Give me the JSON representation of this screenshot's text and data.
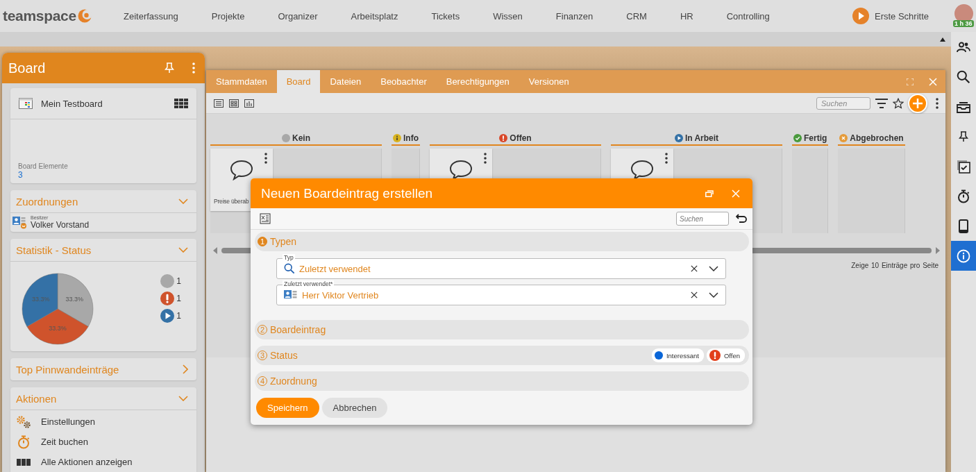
{
  "top_nav": {
    "logo": "teamspace",
    "items": [
      "Zeiterfassung",
      "Projekte",
      "Organizer",
      "Arbeitsplatz",
      "Tickets",
      "Wissen",
      "Finanzen",
      "CRM",
      "HR",
      "Controlling"
    ],
    "getting_started": "Erste Schritte",
    "timer_badge": "1 h 36"
  },
  "right_rail": [
    {
      "kind": "contacts",
      "selected": false
    },
    {
      "kind": "search",
      "selected": false
    },
    {
      "kind": "inbox",
      "selected": false
    },
    {
      "kind": "pin",
      "selected": false
    },
    {
      "kind": "tasks",
      "selected": false
    },
    {
      "kind": "stopwatch",
      "selected": false
    },
    {
      "kind": "phone",
      "selected": false
    },
    {
      "kind": "info",
      "selected": true
    }
  ],
  "board_panel": {
    "title": "Board",
    "board": {
      "name": "Mein Testboard",
      "elements_label": "Board Elemente",
      "elements_count": "3"
    },
    "sections": [
      {
        "kind": "assignments",
        "title": "Zuordnungen",
        "expanded": true,
        "owner_label": "Besitzer",
        "owner": "Volker Vorstand"
      },
      {
        "kind": "statistics",
        "title": "Statistik - Status",
        "expanded": true,
        "chart_data": {
          "type": "pie",
          "values": [
            33.3,
            33.3,
            33.3
          ],
          "value_labels": [
            "33.3%",
            "33.3%",
            "33.3%"
          ]
        },
        "legend": [
          {
            "kind": "neutral",
            "color": "#a8a8a8",
            "count": "1"
          },
          {
            "kind": "open",
            "color": "#cf532c",
            "count": "1"
          },
          {
            "kind": "progress",
            "color": "#3471a6",
            "count": "1"
          }
        ]
      },
      {
        "kind": "pinboard",
        "title": "Top Pinnwandeinträge",
        "expanded": false
      },
      {
        "kind": "actions",
        "title": "Aktionen",
        "expanded": true,
        "items": [
          {
            "kind": "settings",
            "label": "Einstellungen"
          },
          {
            "kind": "time",
            "label": "Zeit buchen"
          },
          {
            "kind": "all",
            "label": "Alle Aktionen anzeigen"
          }
        ]
      }
    ]
  },
  "board_window": {
    "tabs": [
      {
        "label": "Stammdaten",
        "selected": false
      },
      {
        "label": "Board",
        "selected": true
      },
      {
        "label": "Dateien",
        "selected": false
      },
      {
        "label": "Beobachter",
        "selected": false
      },
      {
        "label": "Berechtigungen",
        "selected": false
      },
      {
        "label": "Versionen",
        "selected": false
      }
    ],
    "search": {
      "placeholder": "Suchen"
    },
    "columns": [
      {
        "kind": "neutral",
        "title": "Kein",
        "has_card": true,
        "card_text": "Preise überab"
      },
      {
        "kind": "info",
        "title": "Info",
        "has_card": false
      },
      {
        "kind": "open",
        "title": "Offen",
        "has_card": true
      },
      {
        "kind": "progress",
        "title": "In Arbeit",
        "has_card": true
      },
      {
        "kind": "done",
        "title": "Fertig",
        "has_card": false
      },
      {
        "kind": "cancelled",
        "title": "Abgebrochen",
        "has_card": false
      }
    ],
    "paging": {
      "prefix": "Zeige",
      "page_size": "10",
      "suffix": "Einträge pro Seite"
    }
  },
  "dialog": {
    "title": "Neuen Boardeintrag erstellen",
    "search": {
      "placeholder": "Suchen"
    },
    "sections": [
      {
        "number": "1",
        "title": "Typen",
        "expanded": true,
        "fields": [
          {
            "kind": "search",
            "label": "Typ",
            "value": "Zuletzt verwendet"
          },
          {
            "kind": "contact",
            "label": "Zuletzt verwendet*",
            "value": "Herr Viktor Vertrieb"
          }
        ]
      },
      {
        "number": "2",
        "title": "Boardeintrag",
        "expanded": false
      },
      {
        "number": "3",
        "title": "Status",
        "expanded": false,
        "chips": [
          {
            "kind": "dot",
            "label": "Interessant",
            "color": "#0a66d8"
          },
          {
            "kind": "open",
            "label": "Offen",
            "color": "#e2401c"
          }
        ]
      },
      {
        "number": "4",
        "title": "Zuordnung",
        "expanded": false
      }
    ],
    "buttons": [
      {
        "kind": "primary",
        "label": "Speichern"
      },
      {
        "kind": "secondary",
        "label": "Abbrechen"
      }
    ]
  }
}
